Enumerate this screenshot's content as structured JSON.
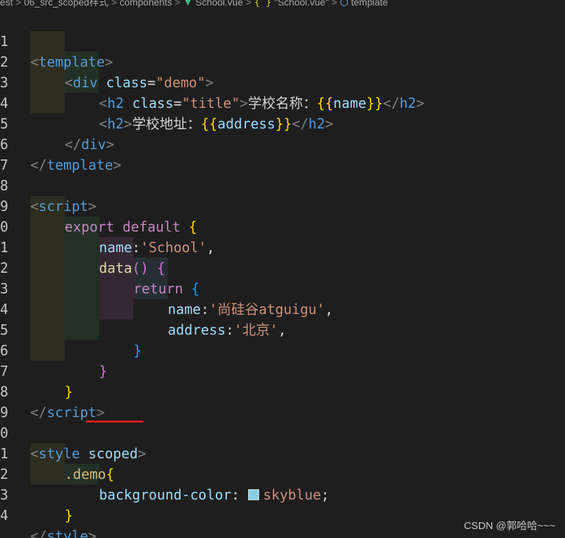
{
  "breadcrumb": {
    "items": [
      "est",
      "06_src_scoped样式",
      "components",
      "School.vue",
      "{ }",
      "\"School.vue\"",
      "template"
    ],
    "separator": ">"
  },
  "line_numbers": [
    "1",
    "2",
    "3",
    "4",
    "5",
    "6",
    "7",
    "8",
    "9",
    "0",
    "1",
    "2",
    "3",
    "4",
    "5",
    "6",
    "7",
    "8",
    "9",
    "0",
    "1",
    "2",
    "3",
    "4"
  ],
  "code": {
    "l1": {
      "open": "<",
      "tag": "template",
      "close": ">"
    },
    "l2": {
      "open": "<",
      "tag": "div",
      "attr": "class",
      "eq": "=",
      "val": "\"demo\"",
      "close": ">"
    },
    "l3": {
      "open": "<",
      "tag": "h2",
      "attr": "class",
      "eq": "=",
      "val": "\"title\"",
      "close": ">",
      "text": "学校名称：",
      "m_open": "{{",
      "var": "name",
      "m_close": "}}",
      "end_open": "</",
      "end_tag": "h2",
      "end_close": ">"
    },
    "l4": {
      "open": "<",
      "tag": "h2",
      "close": ">",
      "text": "学校地址：",
      "m_open": "{{",
      "var": "address",
      "m_close": "}}",
      "end_open": "</",
      "end_tag": "h2",
      "end_close": ">"
    },
    "l5": {
      "open": "</",
      "tag": "div",
      "close": ">"
    },
    "l6": {
      "open": "</",
      "tag": "template",
      "close": ">"
    },
    "l8": {
      "open": "<",
      "tag": "script",
      "close": ">"
    },
    "l9": {
      "kw1": "export",
      "kw2": "default",
      "brace": "{"
    },
    "l10": {
      "prop": "name",
      "colon": ":",
      "str": "'School'",
      "comma": ","
    },
    "l11": {
      "fn": "data",
      "paren": "()",
      "brace": "{"
    },
    "l12": {
      "kw": "return",
      "brace": "{"
    },
    "l13": {
      "prop": "name",
      "colon": ":",
      "str": "'尚硅谷atguigu'",
      "comma": ","
    },
    "l14": {
      "prop": "address",
      "colon": ":",
      "str": "'北京'",
      "comma": ","
    },
    "l15": {
      "brace": "}"
    },
    "l16": {
      "brace": "}"
    },
    "l17": {
      "brace": "}"
    },
    "l18": {
      "open": "</",
      "tag": "script",
      "close": ">"
    },
    "l20": {
      "open": "<",
      "tag": "style",
      "attr": "scoped",
      "close": ">"
    },
    "l21": {
      "selector": ".demo",
      "brace": "{"
    },
    "l22": {
      "prop": "background-color",
      "colon": ":",
      "val": "skyblue",
      "semi": ";"
    },
    "l23": {
      "brace": "}"
    },
    "l24": {
      "open": "</",
      "tag": "style",
      "close": ">"
    }
  },
  "colors": {
    "background": "#1e1e1e",
    "swatch": "#87ceeb",
    "annotation_underline": "#e01e1e"
  },
  "watermark": "CSDN @郭哈哈~~~"
}
